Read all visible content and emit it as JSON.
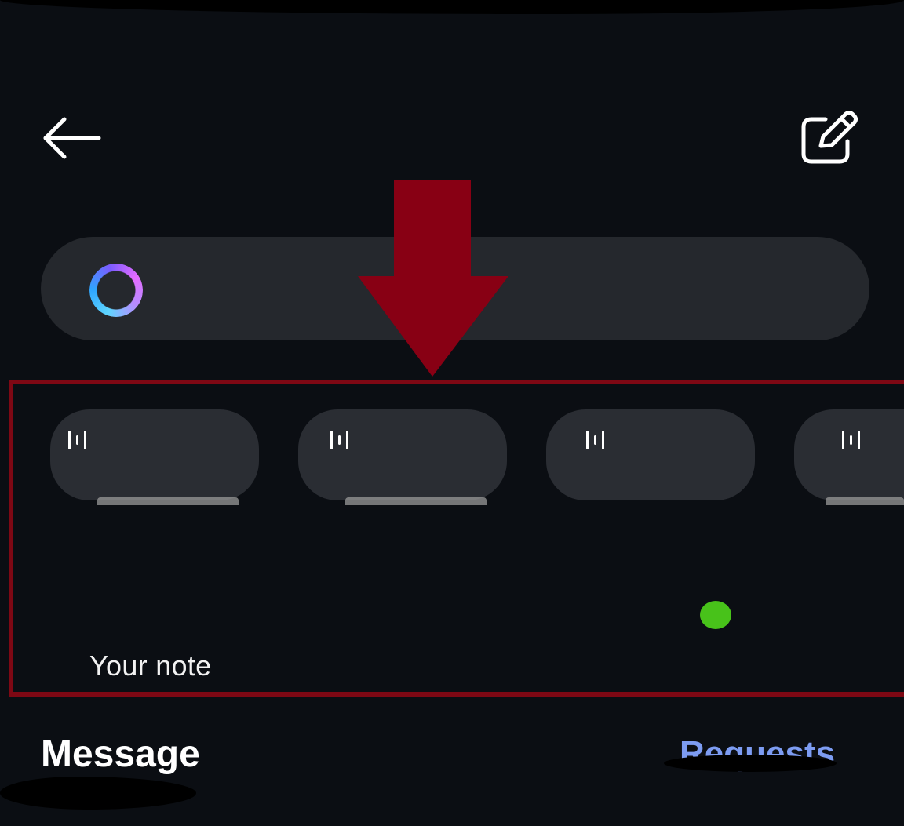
{
  "header": {
    "back_icon": "arrow-left-icon",
    "compose_icon": "edit-square-icon"
  },
  "search": {
    "icon": "ai-ring-icon",
    "value": "",
    "placeholder": ""
  },
  "annotation": {
    "arrow_icon": "down-arrow-icon",
    "color": "#7e0814"
  },
  "notes": {
    "items": [
      {
        "icon": "audio-waveform-icon",
        "label": "Your note"
      },
      {
        "icon": "audio-waveform-icon",
        "label": ""
      },
      {
        "icon": "audio-waveform-icon",
        "label": ""
      },
      {
        "icon": "audio-waveform-icon",
        "label": ""
      }
    ],
    "online_status_color": "#48c21a"
  },
  "messages": {
    "title": "Message",
    "requests_label": "Requests",
    "requests_color": "#7d9cf2"
  }
}
